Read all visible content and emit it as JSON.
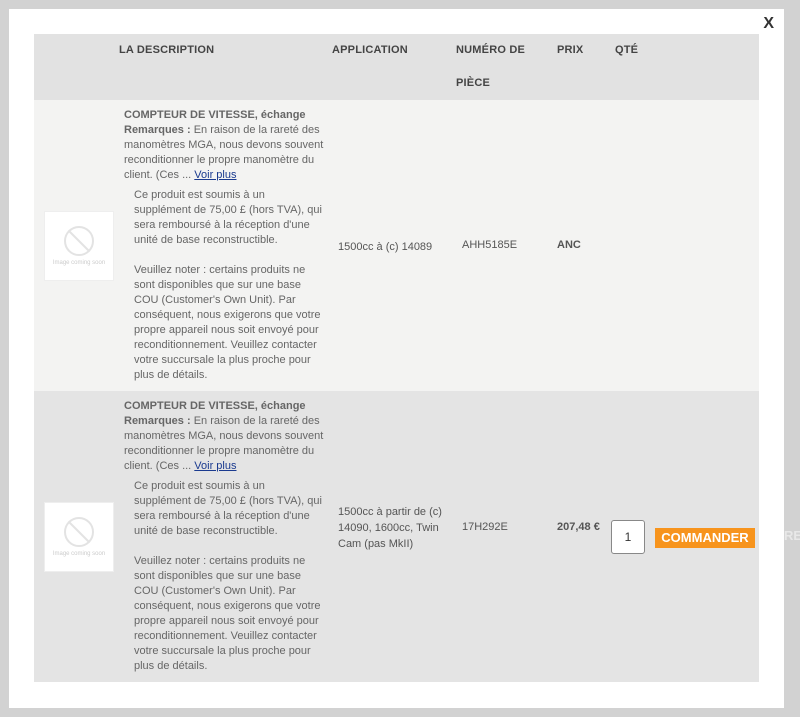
{
  "modal": {
    "close_label": "X"
  },
  "table": {
    "headers": {
      "description": "LA DESCRIPTION",
      "application": "APPLICATION",
      "part_number": "NUMÉRO DE PIÈCE",
      "price": "PRIX",
      "qty": "QTÉ"
    },
    "rows": [
      {
        "thumb_caption": "Image coming soon",
        "title": "COMPTEUR DE VITESSE, échange",
        "remarks_label": "Remarques :",
        "remarks_text": " En raison de la rareté des manomètres MGA, nous devons souvent reconditionner le propre manomètre du client. (Ces ... ",
        "more_link": "Voir plus",
        "note1": "Ce produit est soumis à un supplément de 75,00 £ (hors TVA), qui sera remboursé à la réception d'une unité de base reconstructible.",
        "note2": "Veuillez noter : certains produits ne sont disponibles que sur une base COU (Customer's Own Unit). Par conséquent, nous exigerons que votre propre appareil nous soit envoyé pour reconditionnement. Veuillez contacter votre succursale la plus proche pour plus de détails.",
        "application": "1500cc à (c) 14089",
        "part_number": "AHH5185E",
        "price": "ANC"
      },
      {
        "thumb_caption": "Image coming soon",
        "title": "COMPTEUR DE VITESSE, échange",
        "remarks_label": "Remarques :",
        "remarks_text": " En raison de la rareté des manomètres MGA, nous devons souvent reconditionner le propre manomètre du client. (Ces ... ",
        "more_link": "Voir plus",
        "note1": "Ce produit est soumis à un supplément de 75,00 £ (hors TVA), qui sera remboursé à la réception d'une unité de base reconstructible.",
        "note2": "Veuillez noter : certains produits ne sont disponibles que sur une base COU (Customer's Own Unit). Par conséquent, nous exigerons que votre propre appareil nous soit envoyé pour reconditionnement. Veuillez contacter votre succursale la plus proche pour plus de détails.",
        "application": "1500cc à partir de (c) 14090, 1600cc, Twin Cam (pas MkII)",
        "part_number": "17H292E",
        "price": "207,48 €",
        "qty_value": "1",
        "order_label": "COMMANDER"
      }
    ]
  },
  "edge_fragment": "RE",
  "colors": {
    "order_button": "#f7941d",
    "link": "#1a3a8f"
  }
}
